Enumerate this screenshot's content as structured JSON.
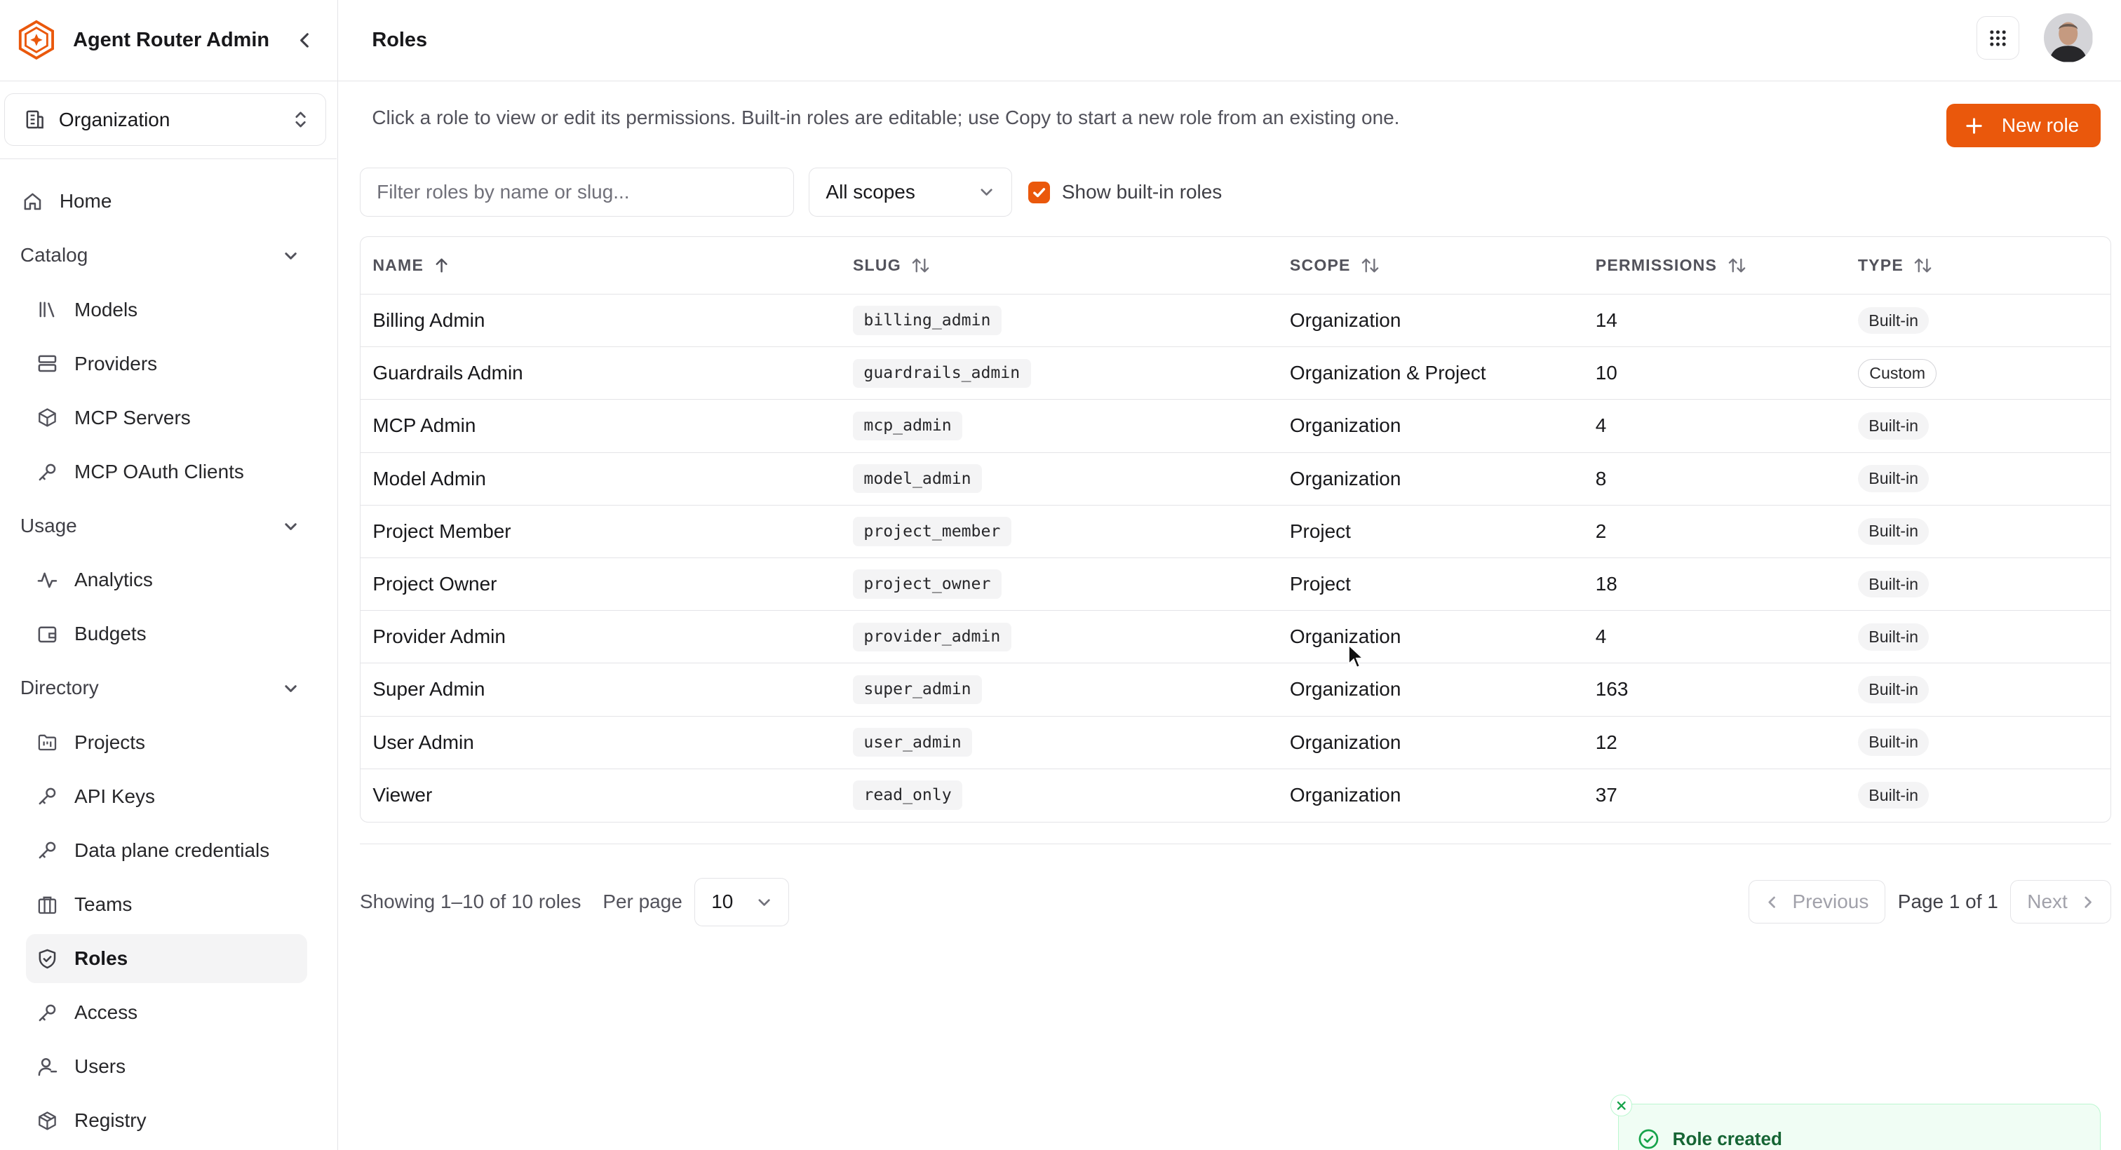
{
  "app": {
    "title": "Agent Router Admin"
  },
  "org_switcher": {
    "label": "Organization"
  },
  "sidebar": {
    "home": "Home",
    "sections": [
      {
        "label": "Catalog",
        "items": [
          {
            "label": "Models",
            "icon": "library-icon"
          },
          {
            "label": "Providers",
            "icon": "server-icon"
          },
          {
            "label": "MCP Servers",
            "icon": "package-icon"
          },
          {
            "label": "MCP OAuth Clients",
            "icon": "key-icon"
          }
        ]
      },
      {
        "label": "Usage",
        "items": [
          {
            "label": "Analytics",
            "icon": "activity-icon"
          },
          {
            "label": "Budgets",
            "icon": "wallet-icon"
          }
        ]
      },
      {
        "label": "Directory",
        "items": [
          {
            "label": "Projects",
            "icon": "folder-kanban-icon"
          },
          {
            "label": "API Keys",
            "icon": "key-icon"
          },
          {
            "label": "Data plane credentials",
            "icon": "key-icon"
          },
          {
            "label": "Teams",
            "icon": "building-icon"
          },
          {
            "label": "Roles",
            "icon": "shield-check-icon",
            "active": true
          },
          {
            "label": "Access",
            "icon": "key-icon"
          },
          {
            "label": "Users",
            "icon": "user-icon"
          },
          {
            "label": "Registry",
            "icon": "boxes-icon"
          }
        ]
      }
    ]
  },
  "header": {
    "title": "Roles"
  },
  "main": {
    "intro": "Click a role to view or edit its permissions. Built-in roles are editable; use Copy to start a new role from an existing one.",
    "new_role_label": "New role",
    "filter": {
      "placeholder": "Filter roles by name or slug...",
      "value": ""
    },
    "scope_select": {
      "value": "All scopes"
    },
    "show_builtin": {
      "label": "Show built-in roles",
      "checked": true
    }
  },
  "table": {
    "columns": [
      "NAME",
      "SLUG",
      "SCOPE",
      "PERMISSIONS",
      "TYPE"
    ],
    "rows": [
      {
        "name": "Billing Admin",
        "slug": "billing_admin",
        "scope": "Organization",
        "permissions": "14",
        "type": "Built-in"
      },
      {
        "name": "Guardrails Admin",
        "slug": "guardrails_admin",
        "scope": "Organization & Project",
        "permissions": "10",
        "type": "Custom"
      },
      {
        "name": "MCP Admin",
        "slug": "mcp_admin",
        "scope": "Organization",
        "permissions": "4",
        "type": "Built-in"
      },
      {
        "name": "Model Admin",
        "slug": "model_admin",
        "scope": "Organization",
        "permissions": "8",
        "type": "Built-in"
      },
      {
        "name": "Project Member",
        "slug": "project_member",
        "scope": "Project",
        "permissions": "2",
        "type": "Built-in"
      },
      {
        "name": "Project Owner",
        "slug": "project_owner",
        "scope": "Project",
        "permissions": "18",
        "type": "Built-in"
      },
      {
        "name": "Provider Admin",
        "slug": "provider_admin",
        "scope": "Organization",
        "permissions": "4",
        "type": "Built-in"
      },
      {
        "name": "Super Admin",
        "slug": "super_admin",
        "scope": "Organization",
        "permissions": "163",
        "type": "Built-in"
      },
      {
        "name": "User Admin",
        "slug": "user_admin",
        "scope": "Organization",
        "permissions": "12",
        "type": "Built-in"
      },
      {
        "name": "Viewer",
        "slug": "read_only",
        "scope": "Organization",
        "permissions": "37",
        "type": "Built-in"
      }
    ]
  },
  "pagination": {
    "showing": "Showing 1–10 of 10 roles",
    "per_page_label": "Per page",
    "per_page_value": "10",
    "previous_label": "Previous",
    "page_label": "Page 1 of 1",
    "next_label": "Next"
  },
  "toast": {
    "label": "Role created"
  },
  "colors": {
    "accent": "#ea580c",
    "success": "#16a34a",
    "border": "#e4e4e7"
  }
}
